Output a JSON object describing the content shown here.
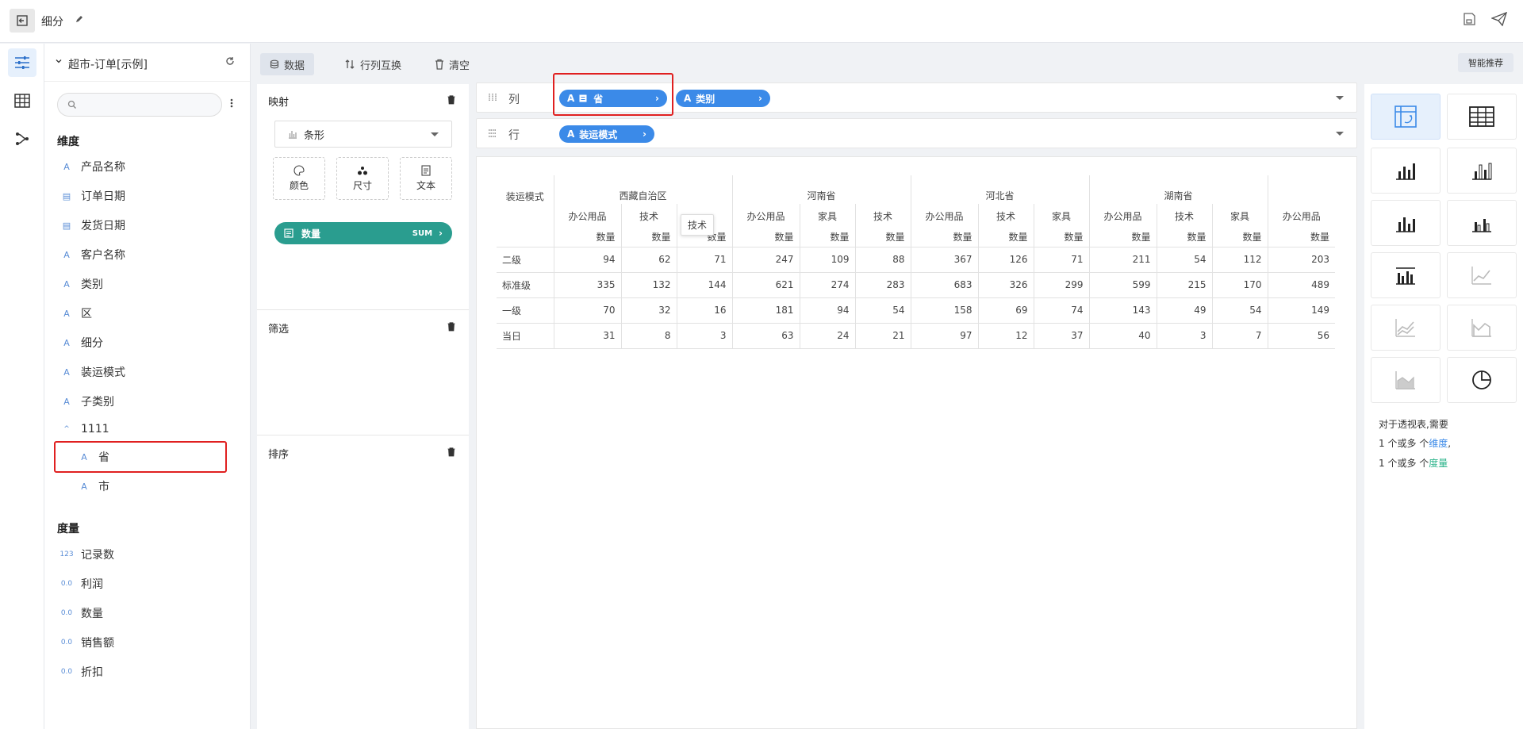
{
  "header": {
    "title": "细分"
  },
  "datasource": {
    "name": "超市-订单[示例]"
  },
  "fields": {
    "dimension_title": "维度",
    "dimensions": [
      {
        "type": "A",
        "label": "产品名称"
      },
      {
        "type": "date",
        "label": "订单日期"
      },
      {
        "type": "date",
        "label": "发货日期"
      },
      {
        "type": "A",
        "label": "客户名称"
      },
      {
        "type": "A",
        "label": "类别"
      },
      {
        "type": "A",
        "label": "区"
      },
      {
        "type": "A",
        "label": "细分"
      },
      {
        "type": "A",
        "label": "装运模式"
      },
      {
        "type": "A",
        "label": "子类别"
      }
    ],
    "group": {
      "label": "1111",
      "children": [
        {
          "type": "A",
          "label": "省"
        },
        {
          "type": "A",
          "label": "市"
        }
      ]
    },
    "measure_title": "度量",
    "measures": [
      {
        "type": "123",
        "label": "记录数"
      },
      {
        "type": "0.0",
        "label": "利润"
      },
      {
        "type": "0.0",
        "label": "数量"
      },
      {
        "type": "0.0",
        "label": "销售额"
      },
      {
        "type": "0.0",
        "label": "折扣"
      }
    ]
  },
  "toolbar": {
    "data": "数据",
    "swap": "行列互换",
    "clear": "清空",
    "smart": "智能推荐"
  },
  "encoding": {
    "mapping_title": "映射",
    "chart_type": "条形",
    "color": "颜色",
    "size": "尺寸",
    "text": "文本",
    "measure_pill": {
      "label": "数量",
      "agg": "SUM"
    },
    "filter_title": "筛选",
    "sort_title": "排序"
  },
  "shelves": {
    "columns_label": "列",
    "column_pills": [
      {
        "type": "A",
        "label": "省"
      },
      {
        "type": "A",
        "label": "类别"
      }
    ],
    "rows_label": "行",
    "row_pills": [
      {
        "type": "A",
        "label": "装运模式"
      }
    ]
  },
  "pivot": {
    "row_header": "装运模式",
    "measure": "数量",
    "provinces": [
      {
        "name": "西藏自治区",
        "categories": [
          "办公用品",
          "技术",
          ""
        ]
      },
      {
        "name": "河南省",
        "categories": [
          "办公用品",
          "家具",
          "技术"
        ]
      },
      {
        "name": "河北省",
        "categories": [
          "办公用品",
          "技术",
          "家具"
        ]
      },
      {
        "name": "湖南省",
        "categories": [
          "办公用品",
          "技术",
          "家具"
        ]
      },
      {
        "name": "",
        "categories": [
          "办公用品"
        ]
      }
    ],
    "rows": [
      {
        "label": "二级",
        "values": [
          94,
          62,
          71,
          247,
          109,
          88,
          367,
          126,
          71,
          211,
          54,
          112,
          203
        ]
      },
      {
        "label": "标准级",
        "values": [
          335,
          132,
          144,
          621,
          274,
          283,
          683,
          326,
          299,
          599,
          215,
          170,
          489
        ]
      },
      {
        "label": "一级",
        "values": [
          70,
          32,
          16,
          181,
          94,
          54,
          158,
          69,
          74,
          143,
          49,
          54,
          149
        ]
      },
      {
        "label": "当日",
        "values": [
          31,
          8,
          3,
          63,
          24,
          21,
          97,
          12,
          37,
          40,
          3,
          7,
          56
        ]
      }
    ],
    "tooltip": "技术"
  },
  "hint": {
    "line1": "对于透视表,需要",
    "line2_pre": "1 个或多 个",
    "line2_hl": "维度",
    "line2_post": ",",
    "line3_pre": "1 个或多 个",
    "line3_hl": "度量"
  },
  "colors": {
    "accent": "#3b8ae8",
    "measure": "#2a9d8f",
    "highlight": "#e02020"
  }
}
